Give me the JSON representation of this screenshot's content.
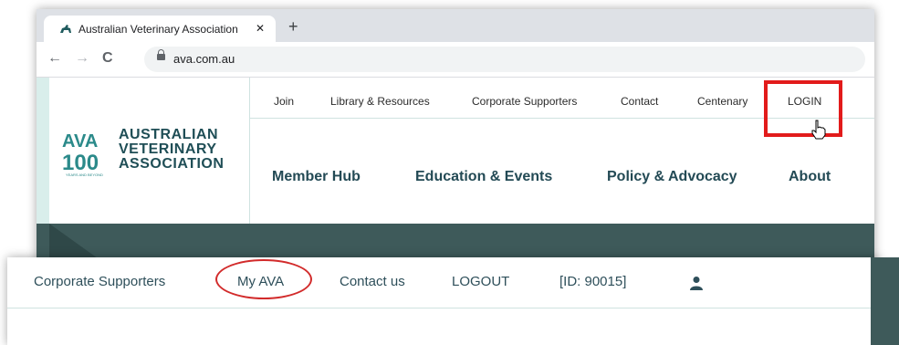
{
  "browser": {
    "tab_title": "Australian Veterinary Association",
    "tab_close": "✕",
    "new_tab": "+",
    "back": "←",
    "forward": "→",
    "reload": "C",
    "url": "ava.com.au"
  },
  "logo": {
    "mark": "AVA",
    "mark_sub": "100",
    "line1": "AUSTRALIAN",
    "line2": "VETERINARY",
    "line3": "ASSOCIATION",
    "tagline": "YEARS AND BEYOND"
  },
  "utility_nav": {
    "join": "Join",
    "library": "Library & Resources",
    "corporate": "Corporate Supporters",
    "contact": "Contact",
    "centenary": "Centenary",
    "login": "LOGIN"
  },
  "main_nav": {
    "member_hub": "Member Hub",
    "education": "Education & Events",
    "policy": "Policy & Advocacy",
    "about": "About"
  },
  "logged_in_nav": {
    "corporate": "Corporate Supporters",
    "my_ava": "My AVA",
    "contact_us": "Contact us",
    "logout": "LOGOUT",
    "member_id": "[ID: 90015]"
  },
  "colors": {
    "highlight_red": "#e21b1b",
    "brand_dark": "#3e5a5a",
    "brand_text": "#234a55"
  }
}
